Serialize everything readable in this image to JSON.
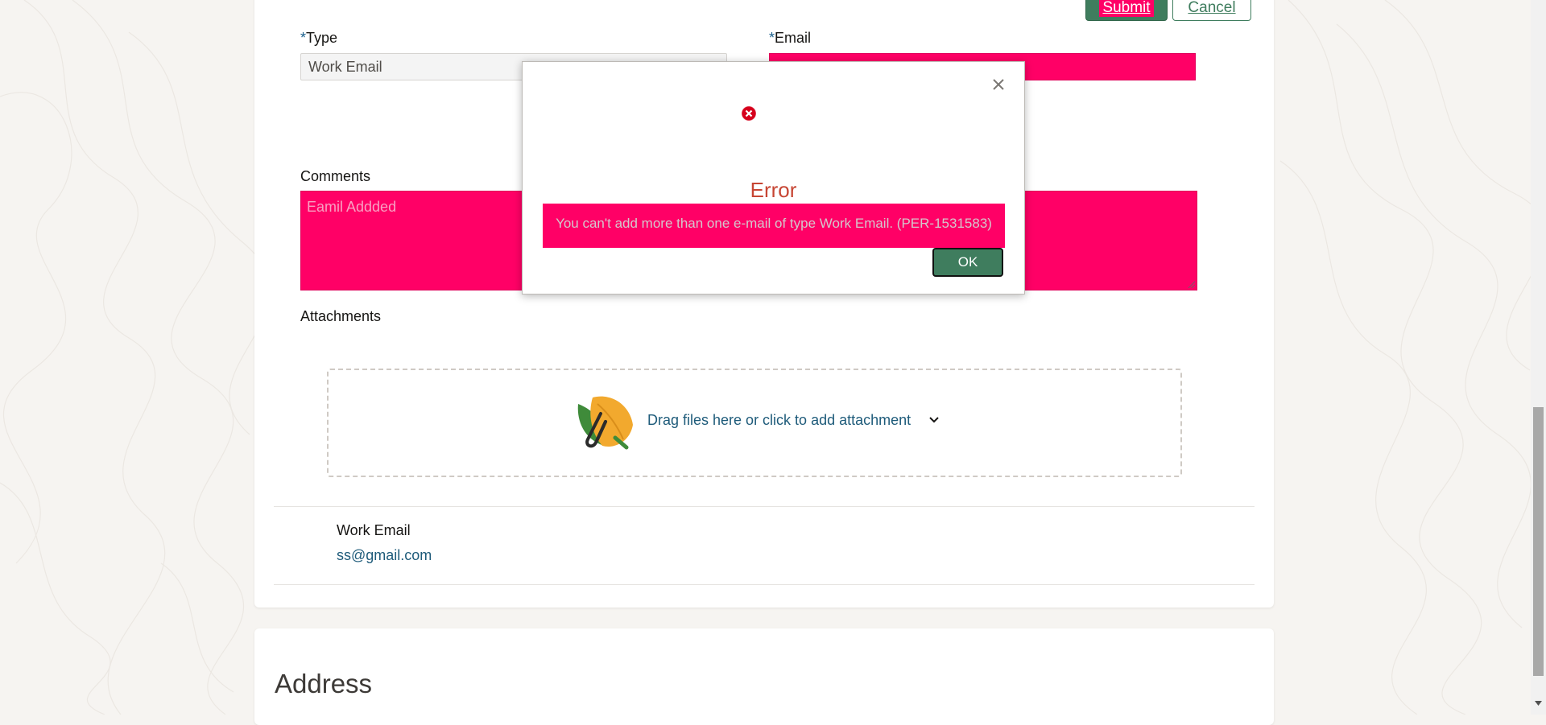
{
  "header_actions": {
    "submit_label": "Submit",
    "cancel_label": "Cancel"
  },
  "form": {
    "type": {
      "required_marker": "*",
      "label": "Type",
      "value": "Work Email"
    },
    "email": {
      "required_marker": "*",
      "label": "Email",
      "value": ""
    },
    "comments": {
      "label": "Comments",
      "value": "Eamil Addded"
    },
    "attachments": {
      "label": "Attachments",
      "dropzone_text": "Drag files here or click to add attachment"
    }
  },
  "email_record": {
    "label": "Work Email",
    "value": "ss@gmail.com"
  },
  "address_section": {
    "title": "Address"
  },
  "dialog": {
    "title": "Error",
    "message": "You can't add more than one e-mail of type Work Email. (PER-1531583)",
    "ok_label": "OK",
    "icon": "error-circle-icon"
  },
  "colors": {
    "accent_green": "#3f7d5e",
    "highlight_pink": "#ff0066",
    "error_red": "#c74634",
    "link_teal": "#1e5b7a"
  }
}
